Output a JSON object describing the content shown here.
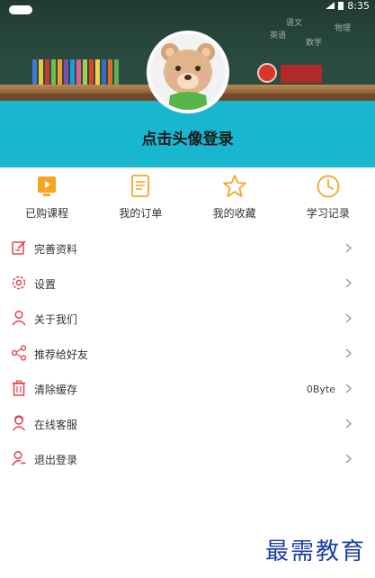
{
  "status": {
    "time": "8:35"
  },
  "banner": {
    "chalk_words": [
      "语文",
      "英语",
      "数学",
      "物理"
    ]
  },
  "profile": {
    "login_prompt": "点击头像登录"
  },
  "quick_actions": [
    {
      "label": "已购课程",
      "icon": "play-course-icon"
    },
    {
      "label": "我的订单",
      "icon": "order-document-icon"
    },
    {
      "label": "我的收藏",
      "icon": "star-icon"
    },
    {
      "label": "学习记录",
      "icon": "clock-icon"
    }
  ],
  "menu": [
    {
      "label": "完善资料",
      "icon": "edit-profile-icon",
      "value": ""
    },
    {
      "label": "设置",
      "icon": "gear-icon",
      "value": ""
    },
    {
      "label": "关于我们",
      "icon": "person-icon",
      "value": ""
    },
    {
      "label": "推荐给好友",
      "icon": "share-icon",
      "value": ""
    },
    {
      "label": "清除缓存",
      "icon": "trash-icon",
      "value": "0Byte"
    },
    {
      "label": "在线客服",
      "icon": "support-agent-icon",
      "value": ""
    },
    {
      "label": "退出登录",
      "icon": "logout-icon",
      "value": ""
    }
  ],
  "watermark": "最需教育",
  "colors": {
    "accent": "#f5a623",
    "menu_icon": "#e0474f",
    "header_panel": "#18b6cf"
  }
}
